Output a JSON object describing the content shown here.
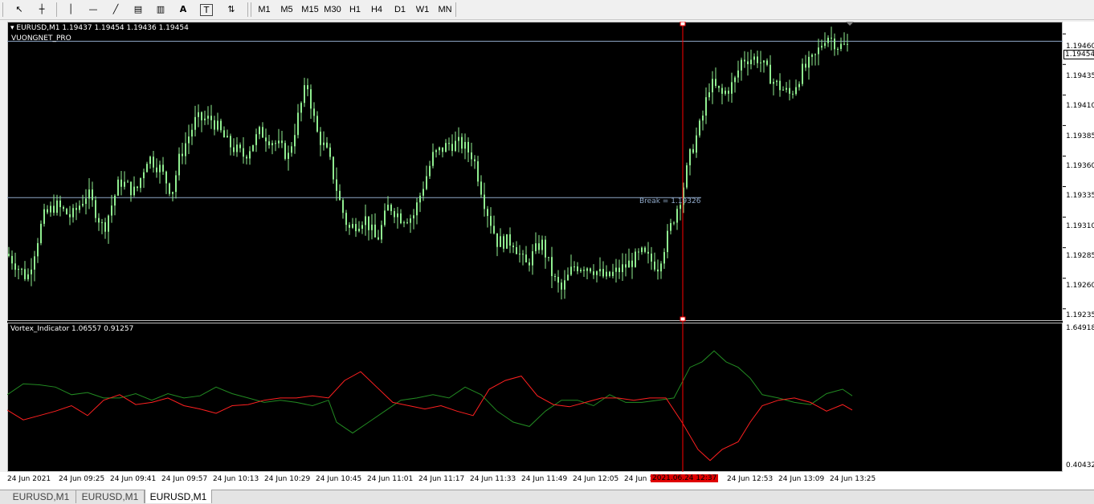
{
  "toolbar": {
    "tools": [
      {
        "name": "cursor-icon",
        "glyph": "↖"
      },
      {
        "name": "crosshair-icon",
        "glyph": "┼"
      },
      {
        "name": "vertical-line-icon",
        "glyph": "│"
      },
      {
        "name": "horizontal-line-icon",
        "glyph": "—"
      },
      {
        "name": "trendline-icon",
        "glyph": "╱"
      },
      {
        "name": "equidistant-channel-icon",
        "glyph": "▤"
      },
      {
        "name": "fibonacci-icon",
        "glyph": "▥"
      },
      {
        "name": "text-icon",
        "glyph": "A"
      },
      {
        "name": "text-label-icon",
        "glyph": "T"
      },
      {
        "name": "arrows-icon",
        "glyph": "⇅"
      }
    ],
    "timeframes": [
      "M1",
      "M5",
      "M15",
      "M30",
      "H1",
      "H4",
      "D1",
      "W1",
      "MN"
    ]
  },
  "chart": {
    "header": "EURUSD,M1  1.19437 1.19454 1.19436 1.19454",
    "expert": "VUONGNET_PRO",
    "break_label": "Break = 1.19326",
    "current_price": "1.19454",
    "price_ticks": [
      "1.19460",
      "1.19435",
      "1.19410",
      "1.19385",
      "1.19360",
      "1.19335",
      "1.19310",
      "1.19285",
      "1.19260",
      "1.19235"
    ],
    "indicator_label": "Vortex_Indicator 1.06557 0.91257",
    "indicator_max": "1.64918",
    "indicator_min": "0.40432",
    "time_ticks": [
      "24 Jun 2021",
      "24 Jun 09:25",
      "24 Jun 09:41",
      "24 Jun 09:57",
      "24 Jun 10:13",
      "24 Jun 10:29",
      "24 Jun 10:45",
      "24 Jun 11:01",
      "24 Jun 11:17",
      "24 Jun 11:33",
      "24 Jun 11:49",
      "24 Jun 12:05",
      "24 Jun 1",
      "24 Jun 12:53",
      "24 Jun 13:09",
      "24 Jun 13:25"
    ],
    "cursor_time": "2021.06.24 12:37",
    "colors": {
      "candle": "#90ee90",
      "vi_plus": "#228b22",
      "vi_minus": "#ff2020",
      "cursor": "#ff0000",
      "hline": "#8fa8c8"
    }
  },
  "tabs": [
    "EURUSD,M1",
    "EURUSD,M1",
    "EURUSD,M1"
  ],
  "price_path": [
    [
      0,
      1.1928
    ],
    [
      25,
      1.1926
    ],
    [
      45,
      1.1931
    ],
    [
      60,
      1.1932
    ],
    [
      80,
      1.1931
    ],
    [
      100,
      1.1933
    ],
    [
      120,
      1.193
    ],
    [
      140,
      1.1934
    ],
    [
      160,
      1.1933
    ],
    [
      175,
      1.1936
    ],
    [
      190,
      1.1935
    ],
    [
      205,
      1.1933
    ],
    [
      215,
      1.1936
    ],
    [
      235,
      1.1939
    ],
    [
      255,
      1.1939
    ],
    [
      275,
      1.1937
    ],
    [
      295,
      1.1936
    ],
    [
      315,
      1.1938
    ],
    [
      335,
      1.1937
    ],
    [
      350,
      1.1936
    ],
    [
      365,
      1.194
    ],
    [
      373,
      1.1942
    ],
    [
      385,
      1.1938
    ],
    [
      400,
      1.1936
    ],
    [
      415,
      1.1932
    ],
    [
      425,
      1.193
    ],
    [
      445,
      1.1931
    ],
    [
      460,
      1.1929
    ],
    [
      475,
      1.1932
    ],
    [
      490,
      1.1931
    ],
    [
      505,
      1.1931
    ],
    [
      515,
      1.1933
    ],
    [
      530,
      1.1936
    ],
    [
      550,
      1.1937
    ],
    [
      565,
      1.1937
    ],
    [
      580,
      1.1936
    ],
    [
      595,
      1.1932
    ],
    [
      610,
      1.1929
    ],
    [
      630,
      1.1929
    ],
    [
      645,
      1.1927
    ],
    [
      665,
      1.1929
    ],
    [
      680,
      1.1926
    ],
    [
      690,
      1.1925
    ],
    [
      705,
      1.1927
    ],
    [
      725,
      1.1927
    ],
    [
      745,
      1.1926
    ],
    [
      770,
      1.1927
    ],
    [
      790,
      1.1928
    ],
    [
      810,
      1.1927
    ],
    [
      825,
      1.193
    ],
    [
      840,
      1.1933
    ],
    [
      850,
      1.1936
    ],
    [
      865,
      1.1939
    ],
    [
      875,
      1.1942
    ],
    [
      890,
      1.1941
    ],
    [
      905,
      1.1942
    ],
    [
      915,
      1.1944
    ],
    [
      935,
      1.1944
    ],
    [
      955,
      1.1942
    ],
    [
      975,
      1.1941
    ],
    [
      990,
      1.1943
    ],
    [
      1005,
      1.1944
    ],
    [
      1020,
      1.1946
    ],
    [
      1035,
      1.1945
    ],
    [
      1048,
      1.1945
    ]
  ],
  "vi_plus_path": [
    [
      0,
      1.05
    ],
    [
      20,
      1.15
    ],
    [
      40,
      1.14
    ],
    [
      60,
      1.12
    ],
    [
      80,
      1.05
    ],
    [
      100,
      1.07
    ],
    [
      120,
      1.02
    ],
    [
      140,
      1.02
    ],
    [
      160,
      1.06
    ],
    [
      180,
      1.0
    ],
    [
      200,
      1.06
    ],
    [
      220,
      1.02
    ],
    [
      240,
      1.04
    ],
    [
      260,
      1.12
    ],
    [
      280,
      1.06
    ],
    [
      300,
      1.02
    ],
    [
      320,
      0.98
    ],
    [
      340,
      1.0
    ],
    [
      360,
      0.98
    ],
    [
      380,
      0.95
    ],
    [
      400,
      1.0
    ],
    [
      410,
      0.8
    ],
    [
      430,
      0.7
    ],
    [
      450,
      0.8
    ],
    [
      470,
      0.9
    ],
    [
      490,
      1.0
    ],
    [
      510,
      1.02
    ],
    [
      530,
      1.05
    ],
    [
      550,
      1.02
    ],
    [
      570,
      1.12
    ],
    [
      590,
      1.05
    ],
    [
      610,
      0.9
    ],
    [
      630,
      0.8
    ],
    [
      650,
      0.76
    ],
    [
      670,
      0.9
    ],
    [
      690,
      1.0
    ],
    [
      710,
      1.0
    ],
    [
      730,
      0.95
    ],
    [
      750,
      1.05
    ],
    [
      770,
      0.98
    ],
    [
      790,
      0.98
    ],
    [
      810,
      1.0
    ],
    [
      830,
      1.02
    ],
    [
      850,
      1.3
    ],
    [
      865,
      1.35
    ],
    [
      880,
      1.45
    ],
    [
      895,
      1.35
    ],
    [
      910,
      1.3
    ],
    [
      925,
      1.2
    ],
    [
      940,
      1.05
    ],
    [
      960,
      1.02
    ],
    [
      980,
      0.98
    ],
    [
      1000,
      0.96
    ],
    [
      1020,
      1.06
    ],
    [
      1040,
      1.1
    ],
    [
      1052,
      1.04
    ]
  ],
  "vi_minus_path": [
    [
      0,
      0.91
    ],
    [
      20,
      0.82
    ],
    [
      40,
      0.86
    ],
    [
      60,
      0.9
    ],
    [
      80,
      0.95
    ],
    [
      100,
      0.86
    ],
    [
      120,
      1.0
    ],
    [
      140,
      1.05
    ],
    [
      160,
      0.96
    ],
    [
      180,
      0.98
    ],
    [
      200,
      1.02
    ],
    [
      220,
      0.95
    ],
    [
      240,
      0.92
    ],
    [
      260,
      0.88
    ],
    [
      280,
      0.95
    ],
    [
      300,
      0.96
    ],
    [
      320,
      1.0
    ],
    [
      340,
      1.02
    ],
    [
      360,
      1.02
    ],
    [
      380,
      1.04
    ],
    [
      400,
      1.02
    ],
    [
      420,
      1.18
    ],
    [
      440,
      1.26
    ],
    [
      460,
      1.12
    ],
    [
      480,
      0.98
    ],
    [
      500,
      0.95
    ],
    [
      520,
      0.92
    ],
    [
      540,
      0.95
    ],
    [
      560,
      0.9
    ],
    [
      580,
      0.86
    ],
    [
      600,
      1.1
    ],
    [
      620,
      1.18
    ],
    [
      640,
      1.22
    ],
    [
      660,
      1.04
    ],
    [
      680,
      0.96
    ],
    [
      700,
      0.94
    ],
    [
      720,
      0.98
    ],
    [
      740,
      1.02
    ],
    [
      760,
      1.02
    ],
    [
      780,
      1.0
    ],
    [
      800,
      1.02
    ],
    [
      820,
      1.02
    ],
    [
      840,
      0.8
    ],
    [
      860,
      0.55
    ],
    [
      875,
      0.45
    ],
    [
      890,
      0.55
    ],
    [
      910,
      0.62
    ],
    [
      925,
      0.8
    ],
    [
      940,
      0.95
    ],
    [
      960,
      1.0
    ],
    [
      980,
      1.02
    ],
    [
      1000,
      0.98
    ],
    [
      1020,
      0.9
    ],
    [
      1040,
      0.96
    ],
    [
      1052,
      0.91
    ]
  ]
}
